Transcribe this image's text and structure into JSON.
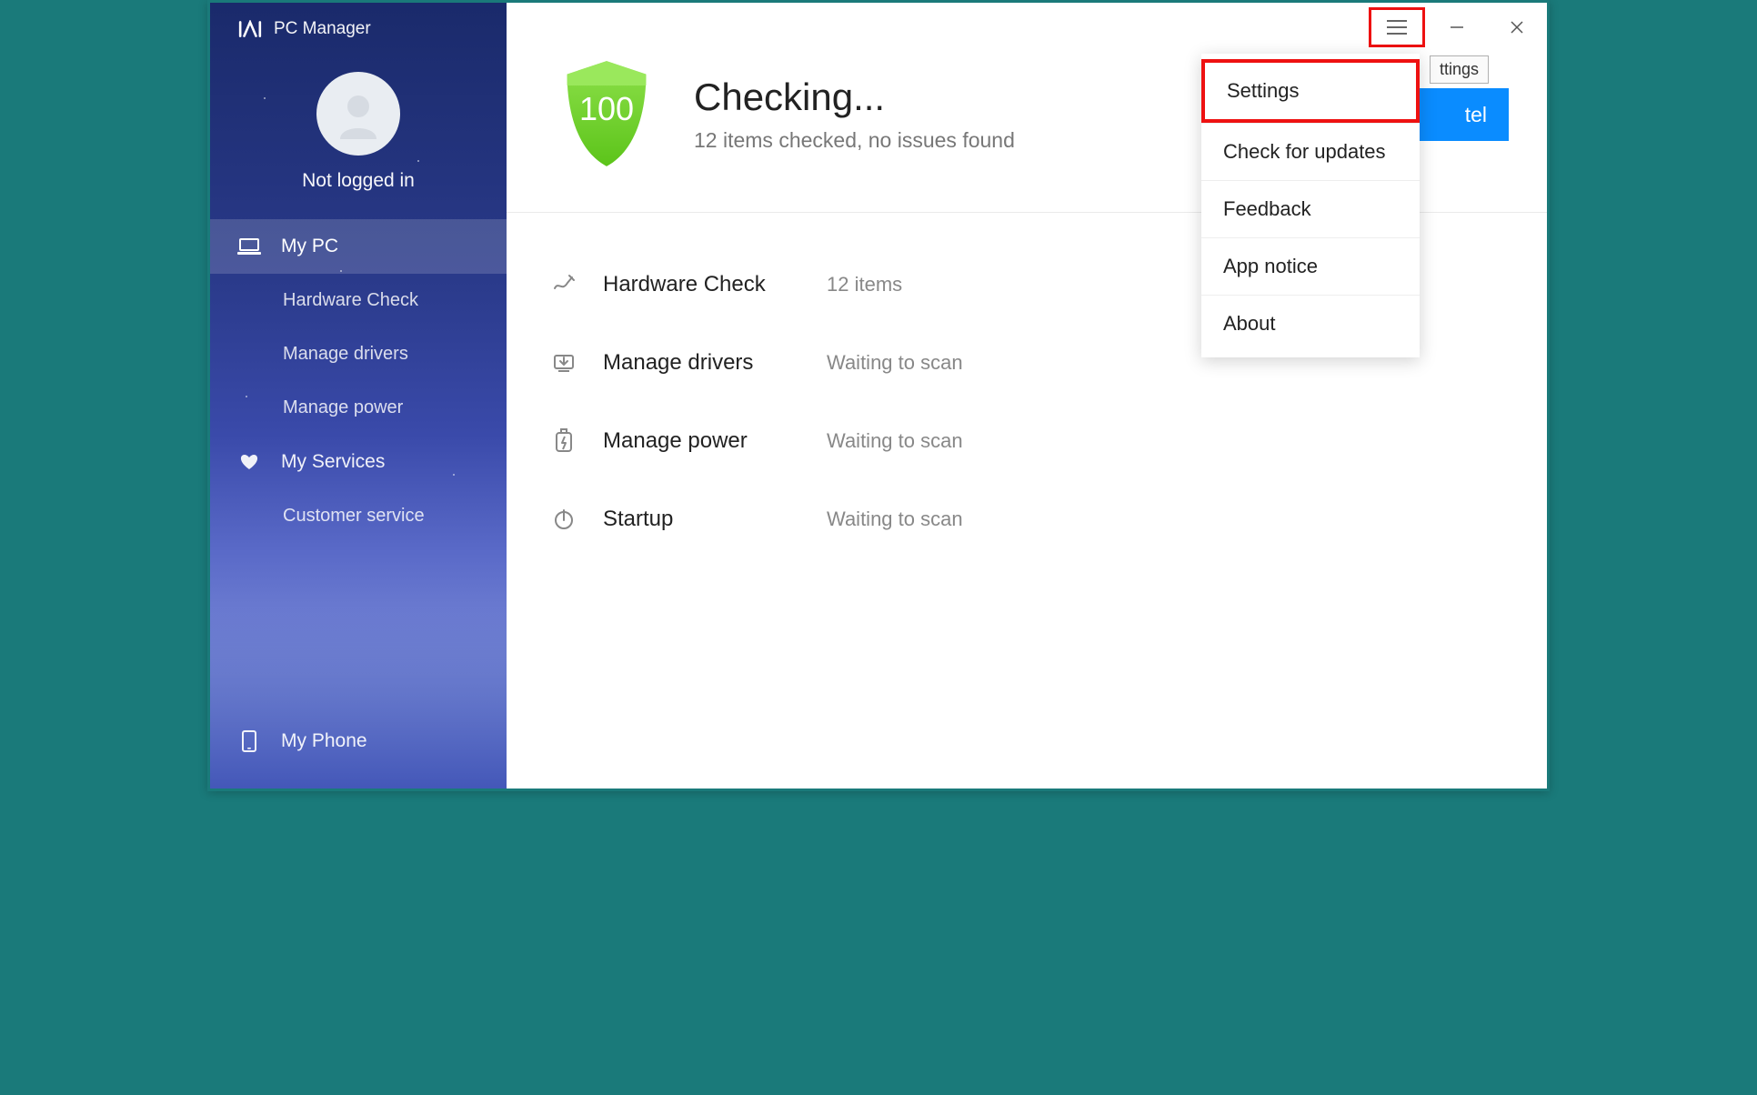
{
  "app": {
    "title": "PC Manager"
  },
  "profile": {
    "name": "Not logged in"
  },
  "sidebar": {
    "items": [
      {
        "label": "My PC"
      },
      {
        "label": "Hardware Check"
      },
      {
        "label": "Manage drivers"
      },
      {
        "label": "Manage power"
      },
      {
        "label": "My Services"
      },
      {
        "label": "Customer service"
      }
    ],
    "bottom": {
      "label": "My Phone"
    }
  },
  "hero": {
    "score": "100",
    "title": "Checking...",
    "subtitle": "12 items checked, no issues found"
  },
  "checks": [
    {
      "label": "Hardware Check",
      "status": "12 items"
    },
    {
      "label": "Manage drivers",
      "status": "Waiting to scan"
    },
    {
      "label": "Manage power",
      "status": "Waiting to scan"
    },
    {
      "label": "Startup",
      "status": "Waiting to scan"
    }
  ],
  "controls": {
    "cancel_visible": "tel",
    "tooltip": "ttings"
  },
  "menu": {
    "items": [
      {
        "label": "Settings"
      },
      {
        "label": "Check for updates"
      },
      {
        "label": "Feedback"
      },
      {
        "label": "App notice"
      },
      {
        "label": "About"
      }
    ]
  }
}
